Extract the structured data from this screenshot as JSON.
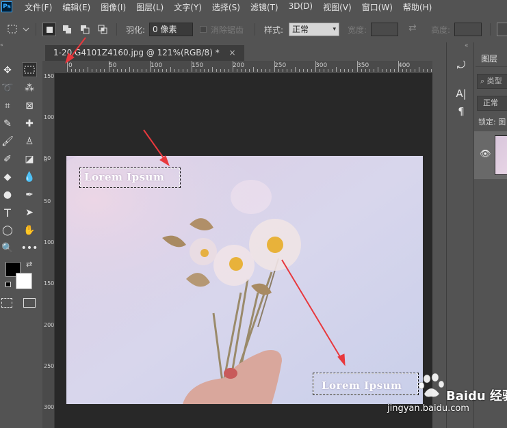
{
  "menubar": {
    "logo": "Ps",
    "items": [
      "文件(F)",
      "编辑(E)",
      "图像(I)",
      "图层(L)",
      "文字(Y)",
      "选择(S)",
      "滤镜(T)",
      "3D(D)",
      "视图(V)",
      "窗口(W)",
      "帮助(H)"
    ]
  },
  "options": {
    "feather_label": "羽化:",
    "feather_value": "0 像素",
    "antialias_label": "消除锯齿",
    "style_label": "样式:",
    "style_value": "正常",
    "width_label": "宽度:",
    "height_label": "高度:"
  },
  "document": {
    "tab_title": "1-20 G4101Z4160.jpg @ 121%(RGB/8) *",
    "close_glyph": "×"
  },
  "ruler": {
    "top_labels": [
      "0",
      "50",
      "100",
      "150",
      "200",
      "250",
      "300",
      "350",
      "400"
    ],
    "left_labels": [
      "150",
      "100",
      "50",
      "0",
      "50",
      "100",
      "150",
      "200",
      "250",
      "300"
    ]
  },
  "canvas": {
    "text1": "Lorem Ipsum",
    "text2": "Lorem Ipsum"
  },
  "layers": {
    "tab_label": "图层",
    "search_placeholder": "类型",
    "blend_mode": "正常",
    "lock_label": "锁定: 图"
  },
  "watermark": {
    "brand": "Baidu 经验",
    "url": "jingyan.baidu.com"
  },
  "colors": {
    "annotation_arrow": "#e8383d",
    "foreground": "#000000",
    "background": "#ffffff"
  }
}
